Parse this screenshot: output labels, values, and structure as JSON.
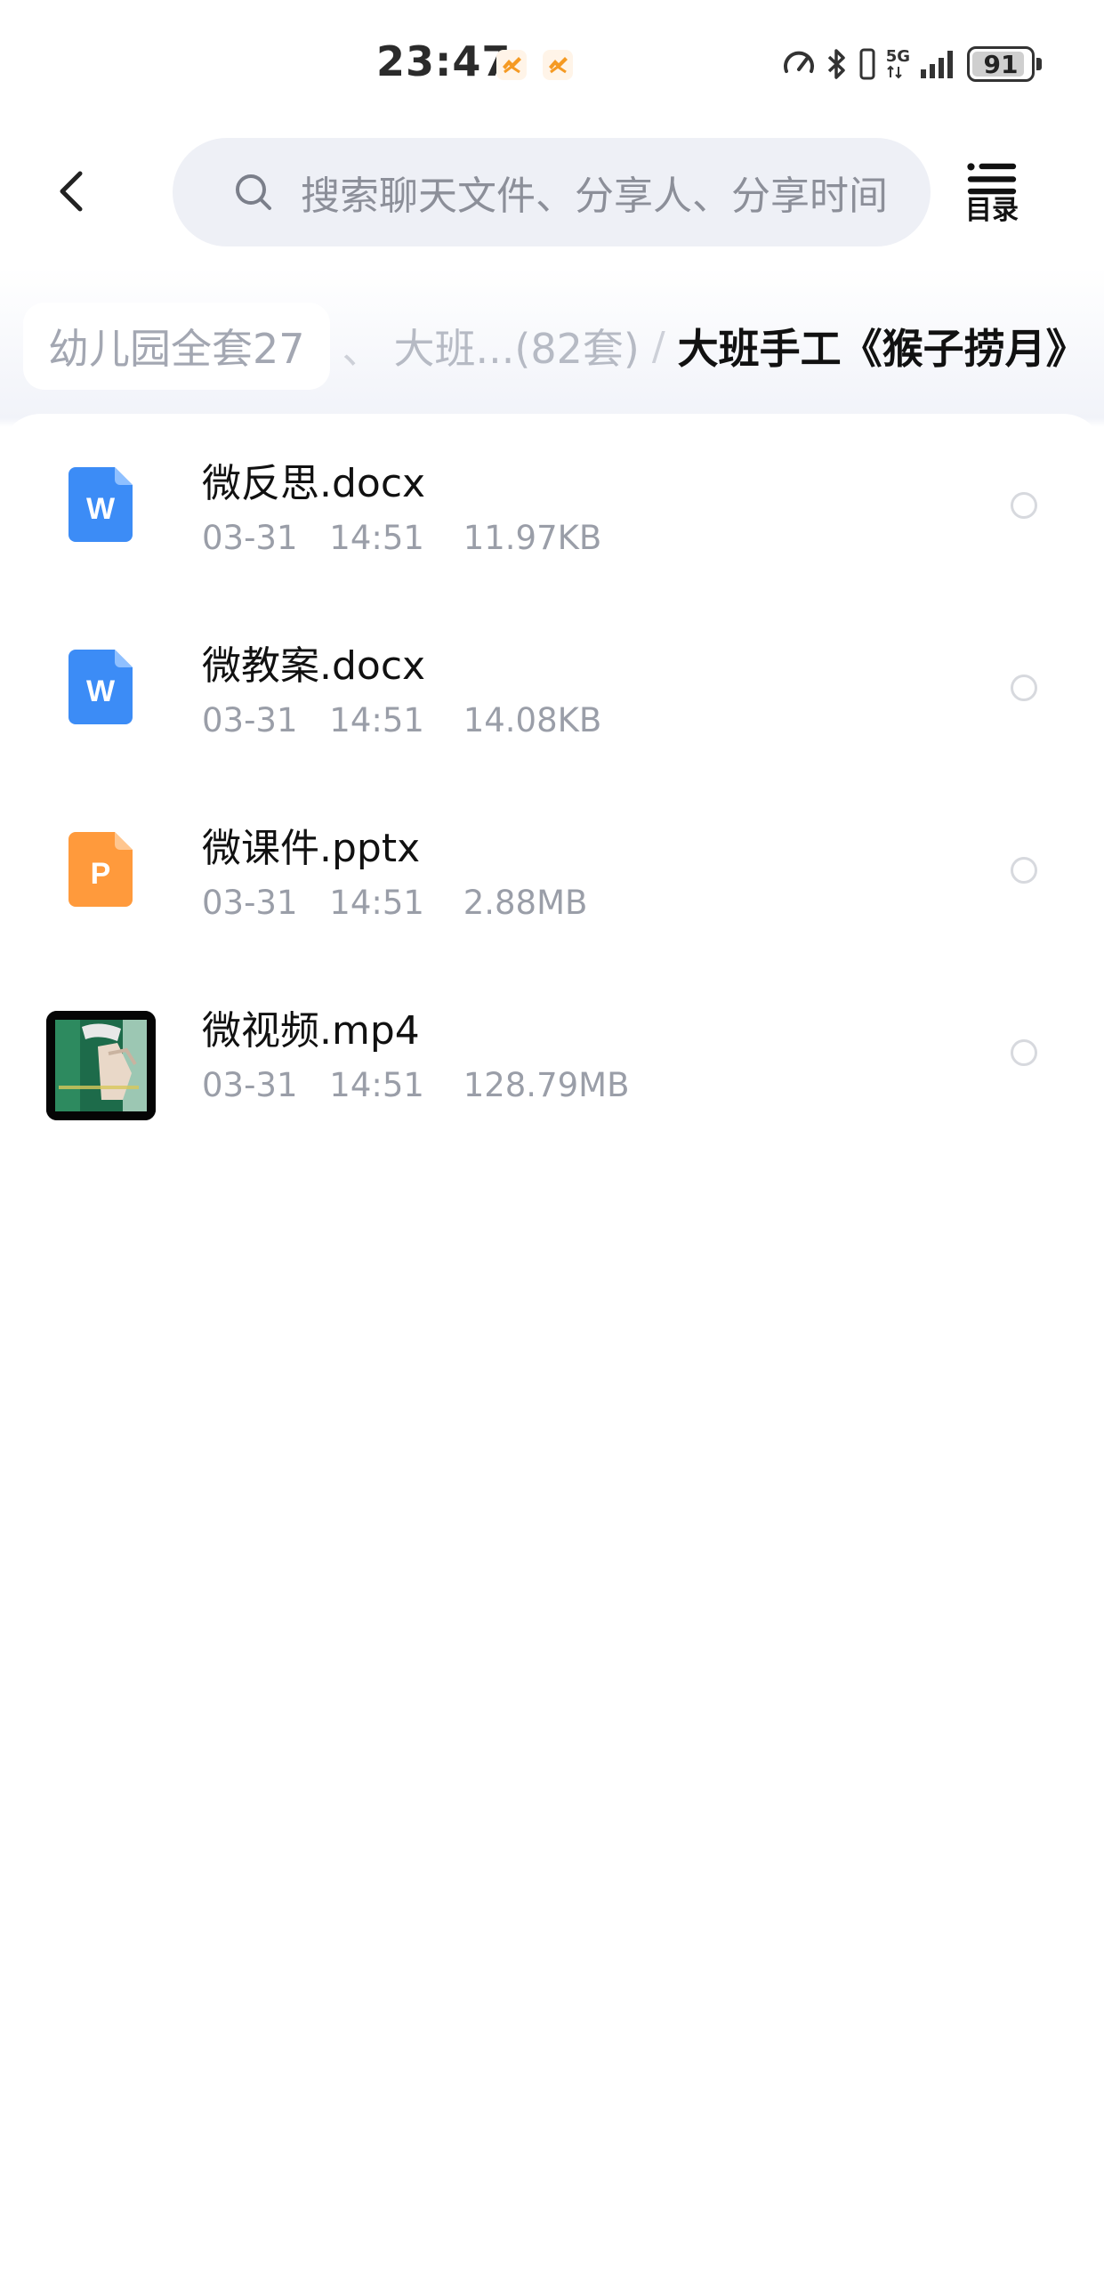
{
  "status_bar": {
    "time": "23:47",
    "network": "5G",
    "battery": "91",
    "battery_level": 0.91,
    "icons": [
      "app-notification-icon",
      "app-notification-icon",
      "speed-icon",
      "bluetooth-icon",
      "vibrate-icon",
      "signal-icon",
      "battery-icon"
    ]
  },
  "toolbar": {
    "search_placeholder": "搜索聊天文件、分享人、分享时间",
    "toc_label": "目录"
  },
  "breadcrumb": {
    "items": [
      "幼儿园全套27",
      "大班...(82套)",
      "大班手工《猴子捞月》"
    ],
    "separators": [
      "、",
      "/"
    ]
  },
  "files": [
    {
      "name": "微反思.docx",
      "date": "03-31",
      "time": "14:51",
      "size": "11.97KB",
      "type": "word",
      "icon_letter": "W"
    },
    {
      "name": "微教案.docx",
      "date": "03-31",
      "time": "14:51",
      "size": "14.08KB",
      "type": "word",
      "icon_letter": "W"
    },
    {
      "name": "微课件.pptx",
      "date": "03-31",
      "time": "14:51",
      "size": "2.88MB",
      "type": "ppt",
      "icon_letter": "P"
    },
    {
      "name": "微视频.mp4",
      "date": "03-31",
      "time": "14:51",
      "size": "128.79MB",
      "type": "video",
      "icon_letter": ""
    }
  ],
  "colors": {
    "word": "#3c8cf6",
    "ppt": "#ff9a3c",
    "search_bg": "#eef0f6",
    "meta_text": "#9a9ea8"
  }
}
